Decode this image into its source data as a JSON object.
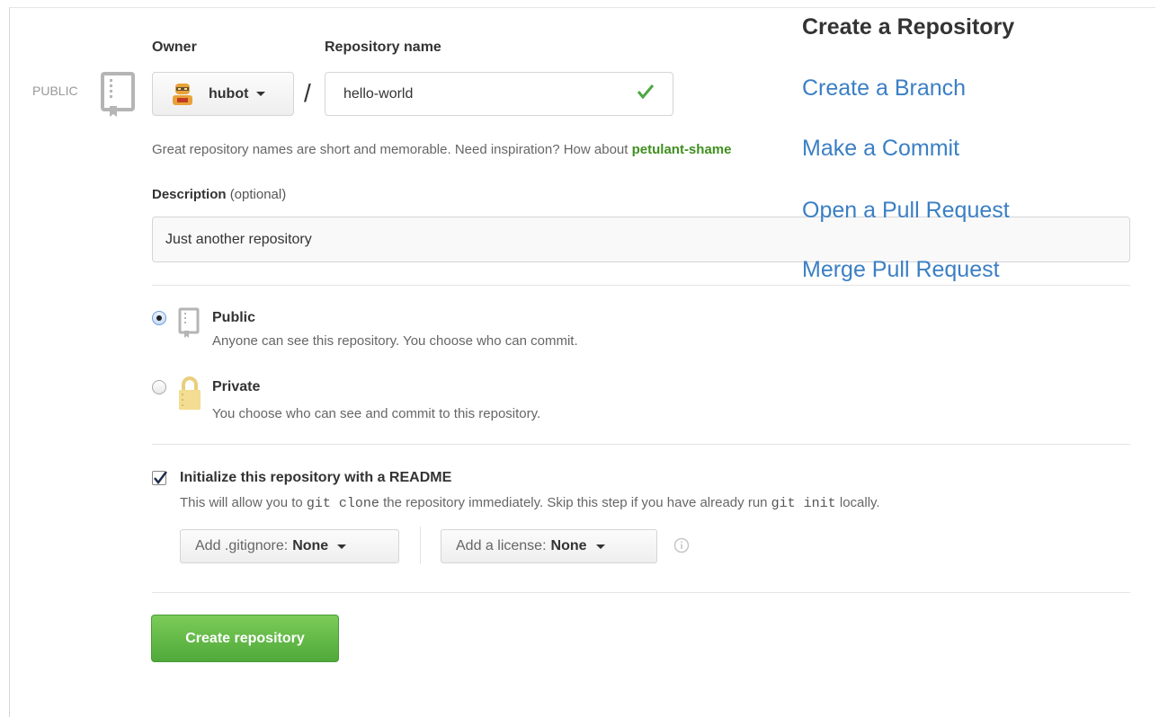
{
  "owner": {
    "label": "Owner",
    "selected": "hubot"
  },
  "repo_name": {
    "label": "Repository name",
    "value": "hello-world",
    "valid": true
  },
  "separator": "/",
  "visibility_badge": "PUBLIC",
  "hint": {
    "text": "Great repository names are short and memorable. Need inspiration? How about ",
    "suggestion": "petulant-shame"
  },
  "description": {
    "label": "Description",
    "optional": "(optional)",
    "value": "Just another repository"
  },
  "visibility_options": {
    "public": {
      "title": "Public",
      "desc": "Anyone can see this repository. You choose who can commit.",
      "selected": true
    },
    "private": {
      "title": "Private",
      "desc": "You choose who can see and commit to this repository.",
      "selected": false
    }
  },
  "init": {
    "title": "Initialize this repository with a README",
    "checked": true,
    "desc_1": "This will allow you to ",
    "code_1": "git clone",
    "desc_2": " the repository immediately. Skip this step if you have already run ",
    "code_2": "git init",
    "desc_3": " locally."
  },
  "gitignore": {
    "label": "Add .gitignore:",
    "value": "None"
  },
  "license": {
    "label": "Add a license:",
    "value": "None"
  },
  "create_button": "Create repository",
  "sidebar": {
    "title": "Create a Repository",
    "links": [
      "Create a Branch",
      "Make a Commit",
      "Open a Pull Request",
      "Merge Pull Request"
    ]
  },
  "colors": {
    "link": "#3b7fc4",
    "primary_green": "#55ae3f",
    "suggestion": "#3f8f1f"
  },
  "icons": [
    "repo-icon",
    "avatar",
    "chevron-down-icon",
    "check-icon",
    "lock-icon",
    "checkbox-icon",
    "info-icon"
  ]
}
